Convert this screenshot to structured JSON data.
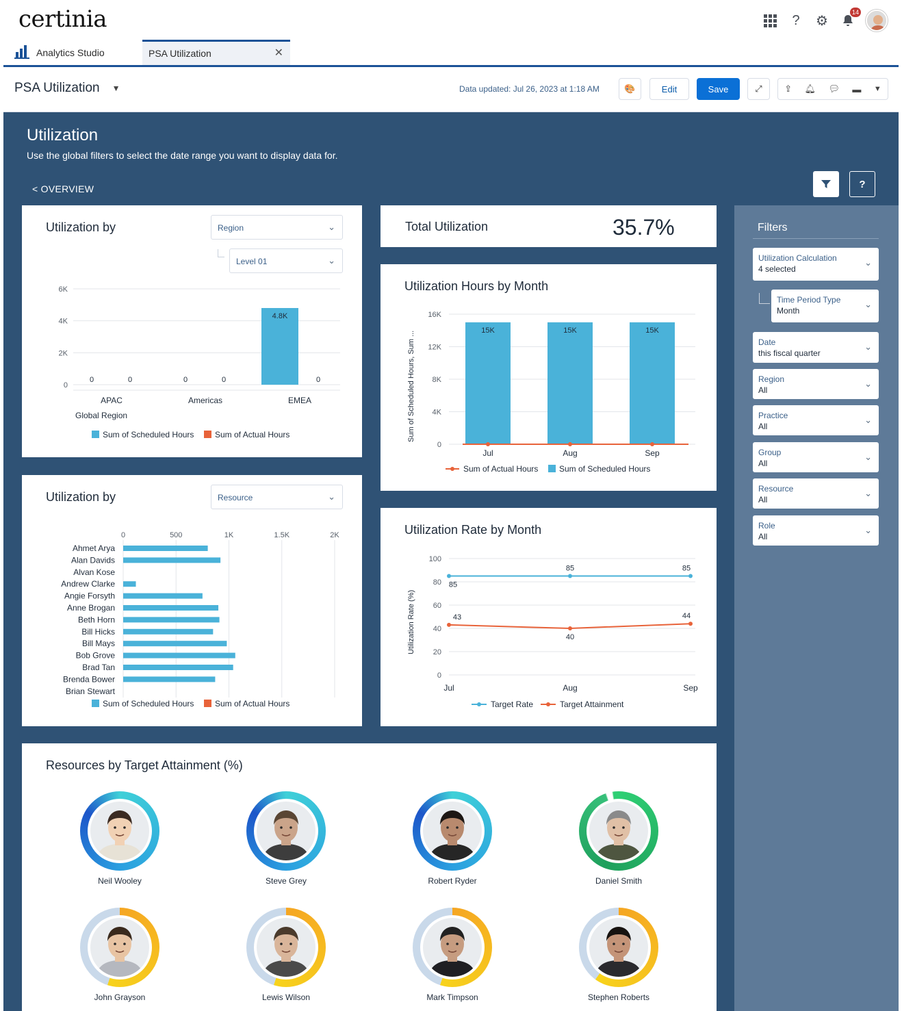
{
  "brand": {
    "logo": "certinia"
  },
  "topbar": {
    "notifications_count": "14"
  },
  "tabs": {
    "app_name": "Analytics Studio",
    "active_tab": "PSA Utilization"
  },
  "dashboard": {
    "title": "PSA Utilization",
    "data_updated": "Data updated: Jul 26, 2023 at 1:18 AM",
    "edit_label": "Edit",
    "save_label": "Save"
  },
  "page": {
    "title": "Utilization",
    "subtitle": "Use the global filters to select the date range you want to display data for.",
    "back_link": "< OVERVIEW",
    "help_label": "?"
  },
  "colors": {
    "scheduled": "#4ab2d9",
    "actual": "#e8633a",
    "header_bg": "#2f5275",
    "brand_blue": "#0b70d6"
  },
  "util_region_card": {
    "title": "Utilization by",
    "dropdown_value": "Region",
    "level_value": "Level 01",
    "xlabel": "Global Region",
    "legend": [
      "Sum of Scheduled Hours",
      "Sum of Actual Hours"
    ]
  },
  "util_resource_card": {
    "title": "Utilization by",
    "dropdown_value": "Resource",
    "legend": [
      "Sum of Scheduled Hours",
      "Sum of Actual Hours"
    ]
  },
  "total_util": {
    "label": "Total Utilization",
    "value": "35.7%"
  },
  "hours_card": {
    "title": "Utilization Hours by Month",
    "ylabel": "Sum of Scheduled Hours, Sum ...",
    "legend": [
      "Sum of Actual Hours",
      "Sum of Scheduled Hours"
    ]
  },
  "rate_card": {
    "title": "Utilization Rate by Month",
    "ylabel": "Utilization Rate (%)",
    "legend": [
      "Target Rate",
      "Target Attainment"
    ]
  },
  "resources_card": {
    "title": "Resources by Target Attainment (%)",
    "people": [
      {
        "name": "Neil Wooley",
        "ring": "teal"
      },
      {
        "name": "Steve Grey",
        "ring": "teal"
      },
      {
        "name": "Robert Ryder",
        "ring": "teal"
      },
      {
        "name": "Daniel Smith",
        "ring": "green"
      },
      {
        "name": "John Grayson",
        "ring": "yellow",
        "attainment": 0.55
      },
      {
        "name": "Lewis Wilson",
        "ring": "yellow",
        "attainment": 0.55
      },
      {
        "name": "Mark Timpson",
        "ring": "yellow",
        "attainment": 0.55
      },
      {
        "name": "Stephen Roberts",
        "ring": "yellow",
        "attainment": 0.6
      }
    ]
  },
  "filters": {
    "title": "Filters",
    "items": [
      {
        "label": "Utilization Calculation",
        "value": "4 selected"
      },
      {
        "label": "Time Period Type",
        "value": "Month"
      },
      {
        "label": "Date",
        "value": "this fiscal quarter"
      },
      {
        "label": "Region",
        "value": "All"
      },
      {
        "label": "Practice",
        "value": "All"
      },
      {
        "label": "Group",
        "value": "All"
      },
      {
        "label": "Resource",
        "value": "All"
      },
      {
        "label": "Role",
        "value": "All"
      }
    ]
  },
  "chart_data": [
    {
      "type": "bar",
      "categories": [
        "APAC",
        "Americas",
        "EMEA"
      ],
      "xlabel": "Global Region",
      "ylim": [
        0,
        6000
      ],
      "yticks": [
        "0",
        "2K",
        "4K",
        "6K"
      ],
      "series": [
        {
          "name": "Sum of Scheduled Hours",
          "values": [
            0,
            0,
            4800
          ],
          "labels": [
            "0",
            "0",
            "4.8K"
          ]
        },
        {
          "name": "Sum of Actual Hours",
          "values": [
            0,
            0,
            0
          ],
          "labels": [
            "0",
            "0",
            "0"
          ]
        }
      ]
    },
    {
      "type": "bar",
      "orientation": "horizontal",
      "categories": [
        "Ahmet Arya",
        "Alan Davids",
        "Alvan Kose",
        "Andrew Clarke",
        "Angie Forsyth",
        "Anne Brogan",
        "Beth Horn",
        "Bill Hicks",
        "Bill Mays",
        "Bob Grove",
        "Brad Tan",
        "Brenda Bower",
        "Brian Stewart"
      ],
      "xlim": [
        0,
        2000
      ],
      "xticks": [
        "0",
        "500",
        "1K",
        "1.5K",
        "2K"
      ],
      "series": [
        {
          "name": "Sum of Scheduled Hours",
          "values": [
            800,
            920,
            0,
            120,
            750,
            900,
            910,
            850,
            980,
            1060,
            1040,
            870,
            0
          ]
        },
        {
          "name": "Sum of Actual Hours",
          "values": [
            0,
            0,
            0,
            0,
            0,
            0,
            0,
            0,
            0,
            0,
            0,
            0,
            0
          ]
        }
      ]
    },
    {
      "type": "bar",
      "categories": [
        "Jul",
        "Aug",
        "Sep"
      ],
      "ylabel": "Sum of Scheduled Hours, Sum ...",
      "ylim": [
        0,
        16000
      ],
      "yticks": [
        "0",
        "4K",
        "8K",
        "12K",
        "16K"
      ],
      "series": [
        {
          "name": "Sum of Scheduled Hours",
          "values": [
            15000,
            15000,
            15000
          ],
          "labels": [
            "15K",
            "15K",
            "15K"
          ]
        },
        {
          "name": "Sum of Actual Hours",
          "type": "line",
          "values": [
            0,
            0,
            0
          ]
        }
      ]
    },
    {
      "type": "line",
      "x": [
        "Jul",
        "Aug",
        "Sep"
      ],
      "ylabel": "Utilization Rate (%)",
      "ylim": [
        0,
        100
      ],
      "yticks": [
        "0",
        "20",
        "40",
        "60",
        "80",
        "100"
      ],
      "series": [
        {
          "name": "Target Rate",
          "values": [
            85,
            85,
            85
          ]
        },
        {
          "name": "Target Attainment",
          "values": [
            43,
            40,
            44
          ]
        }
      ]
    }
  ]
}
